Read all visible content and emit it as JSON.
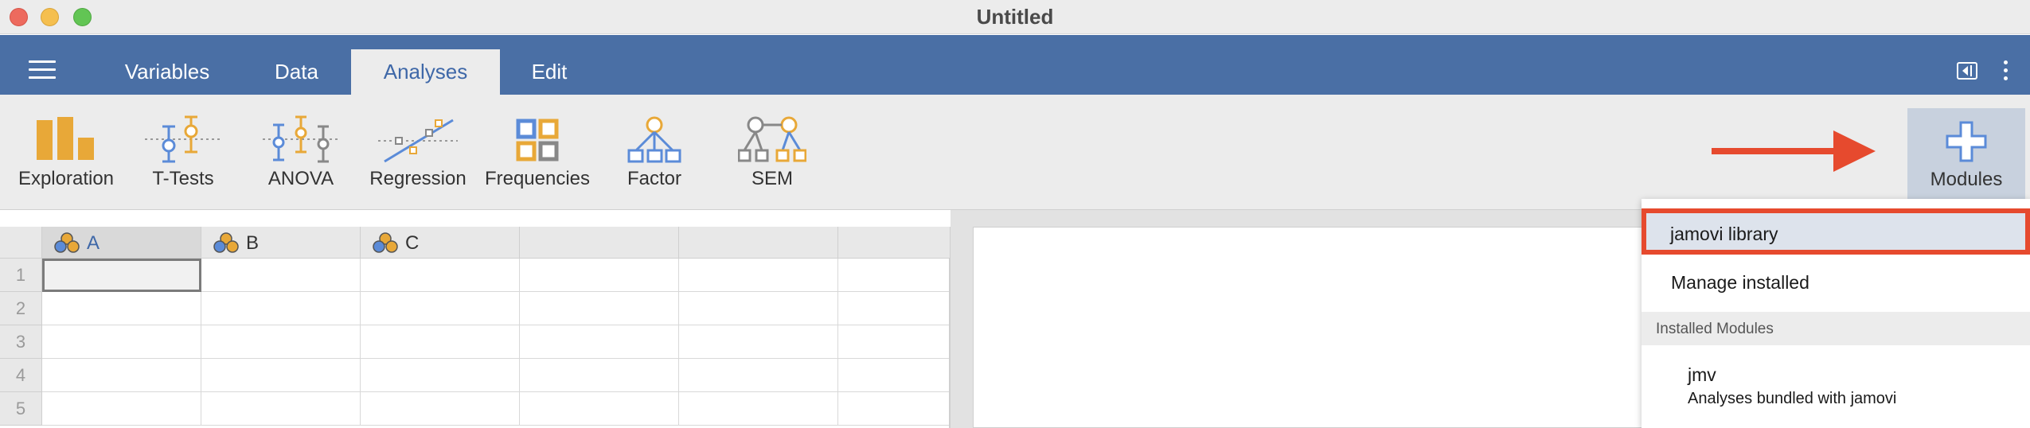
{
  "window": {
    "title": "Untitled"
  },
  "menubar": {
    "tabs": [
      {
        "label": "Variables"
      },
      {
        "label": "Data"
      },
      {
        "label": "Analyses"
      },
      {
        "label": "Edit"
      }
    ],
    "active_tab": "Analyses"
  },
  "ribbon": {
    "tools": [
      {
        "label": "Exploration",
        "icon": "exploration-icon"
      },
      {
        "label": "T-Tests",
        "icon": "t-tests-icon"
      },
      {
        "label": "ANOVA",
        "icon": "anova-icon"
      },
      {
        "label": "Regression",
        "icon": "regression-icon"
      },
      {
        "label": "Frequencies",
        "icon": "frequencies-icon"
      },
      {
        "label": "Factor",
        "icon": "factor-icon"
      },
      {
        "label": "SEM",
        "icon": "sem-icon"
      }
    ],
    "modules_label": "Modules"
  },
  "spreadsheet": {
    "columns": [
      "A",
      "B",
      "C",
      "",
      "",
      ""
    ],
    "rows": [
      "1",
      "2",
      "3",
      "4",
      "5"
    ]
  },
  "modules_menu": {
    "library": "jamovi library",
    "manage": "Manage installed",
    "section_title": "Installed Modules",
    "installed": [
      {
        "name": "jmv",
        "description": "Analyses bundled with jamovi"
      }
    ]
  },
  "colors": {
    "menubar": "#4a6fa5",
    "highlight_box": "#e64a2e",
    "annotation_arrow": "#e64a2e",
    "icon_orange": "#e8a838",
    "icon_blue": "#5b8bd8"
  }
}
